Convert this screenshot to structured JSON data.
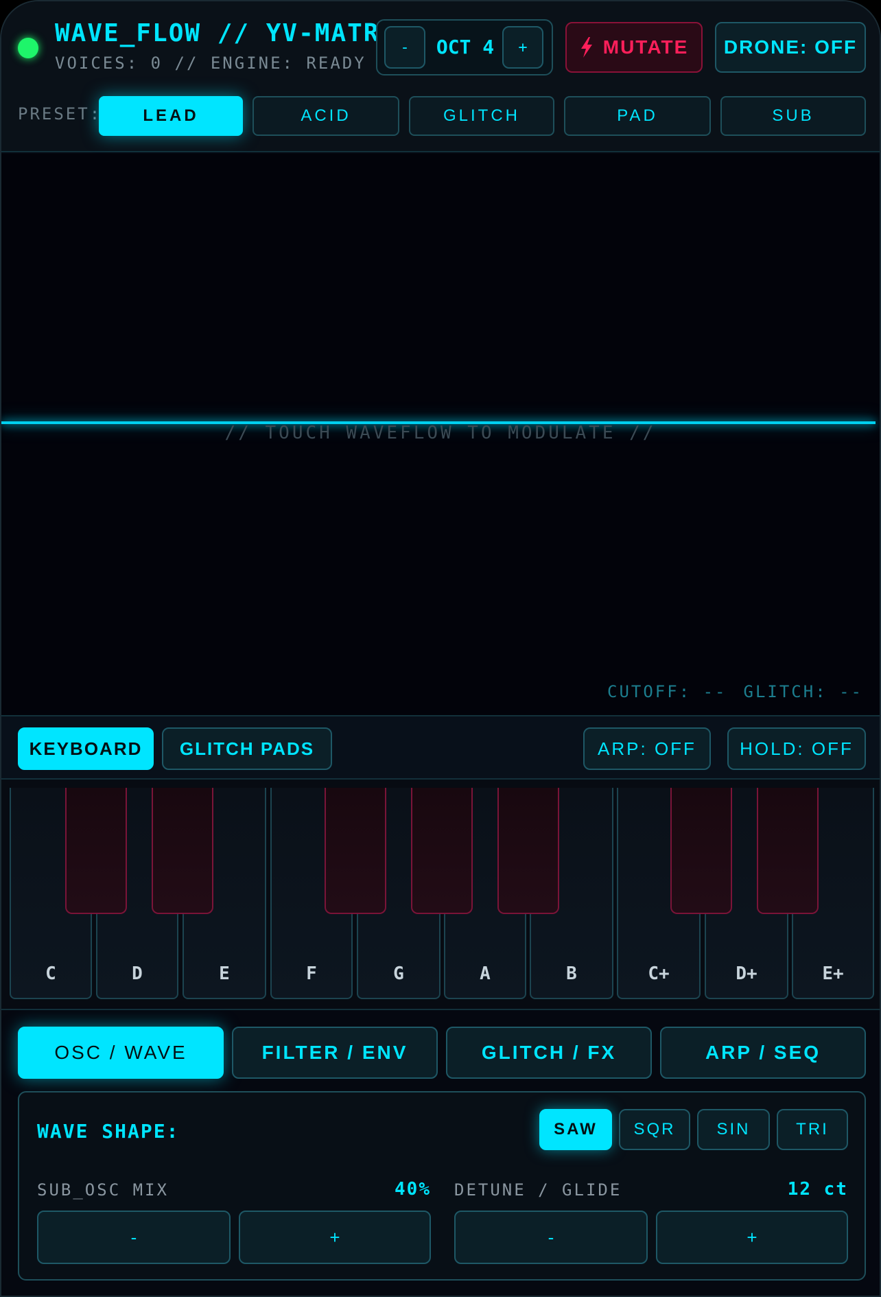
{
  "header": {
    "title": "WAVE_FLOW // YV-MATRIX",
    "status": "VOICES: 0 // ENGINE: READY",
    "octave": {
      "minus": "-",
      "label": "OCT 4",
      "plus": "+"
    },
    "mutate_label": "MUTATE",
    "drone_label": "DRONE: OFF"
  },
  "presets": {
    "label": "PRESET:",
    "items": [
      "LEAD",
      "ACID",
      "GLITCH",
      "PAD",
      "SUB"
    ],
    "active": "LEAD"
  },
  "wave": {
    "hint": "// TOUCH WAVEFLOW TO MODULATE //",
    "cutoff": "CUTOFF: --",
    "glitch": "GLITCH: --"
  },
  "modes": {
    "keyboard": "KEYBOARD",
    "glitch_pads": "GLITCH PADS",
    "arp": "ARP: OFF",
    "hold": "HOLD: OFF"
  },
  "keyboard": {
    "white_keys": [
      "C",
      "D",
      "E",
      "F",
      "G",
      "A",
      "B",
      "C+",
      "D+",
      "E+"
    ]
  },
  "tabs": [
    "OSC / WAVE",
    "FILTER / ENV",
    "GLITCH / FX",
    "ARP / SEQ"
  ],
  "osc": {
    "wave_shape_label": "WAVE SHAPE:",
    "shapes": [
      "SAW",
      "SQR",
      "SIN",
      "TRI"
    ],
    "sub_osc": {
      "label": "SUB_OSC MIX",
      "value": "40%",
      "minus": "-",
      "plus": "+"
    },
    "detune": {
      "label": "DETUNE / GLIDE",
      "value": "12 ct",
      "minus": "-",
      "plus": "+"
    }
  },
  "colors": {
    "accent": "#00e5ff",
    "danger": "#ff1f5a",
    "status_ok": "#1ef56a"
  }
}
